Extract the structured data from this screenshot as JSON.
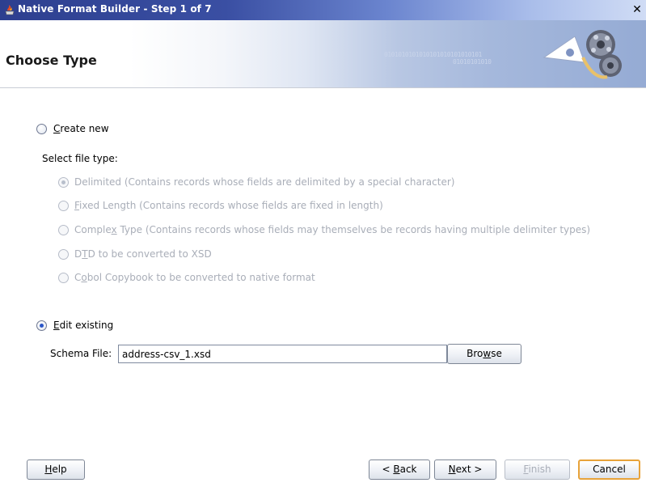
{
  "window": {
    "title": "Native Format Builder - Step 1 of 7",
    "close_glyph": "✕"
  },
  "header": {
    "page_title": "Choose Type",
    "banner_bits_1": "0101010101010101010101010101",
    "banner_bits_2": "01010101010"
  },
  "options": {
    "create_new": {
      "prefix": "",
      "mnemonic": "C",
      "rest": "reate new",
      "selected": false
    },
    "select_file_type_label": "Select file type:",
    "file_types": [
      {
        "pre": "Delimited (Contains records whose fields are delimited by a special character)",
        "mn": "",
        "post": "",
        "selected": true
      },
      {
        "pre": "",
        "mn": "F",
        "post": "ixed Length (Contains records whose fields are fixed in length)",
        "selected": false
      },
      {
        "pre": "Comple",
        "mn": "x",
        "post": " Type (Contains records whose fields may themselves be records having multiple delimiter types)",
        "selected": false
      },
      {
        "pre": "D",
        "mn": "T",
        "post": "D to be converted to XSD",
        "selected": false
      },
      {
        "pre": "C",
        "mn": "o",
        "post": "bol Copybook to be converted to native format",
        "selected": false
      }
    ],
    "edit_existing": {
      "mnemonic": "E",
      "rest": "dit existing",
      "selected": true
    }
  },
  "schema": {
    "label": "Schema File:",
    "value": "address-csv_1.xsd",
    "browse": {
      "pre": "Bro",
      "mn": "w",
      "post": "se"
    }
  },
  "footer": {
    "help": {
      "pre": "",
      "mn": "H",
      "post": "elp"
    },
    "back": {
      "pre": "< ",
      "mn": "B",
      "post": "ack"
    },
    "next": {
      "pre": "",
      "mn": "N",
      "post": "ext >"
    },
    "finish": {
      "pre": "",
      "mn": "F",
      "post": "inish"
    },
    "cancel": "Cancel"
  },
  "colors": {
    "titlebar_start": "#2d3f8f",
    "radio_dot": "#2b56c8",
    "disabled_text": "#a9aeb8",
    "default_button_border": "#e8a33a"
  }
}
